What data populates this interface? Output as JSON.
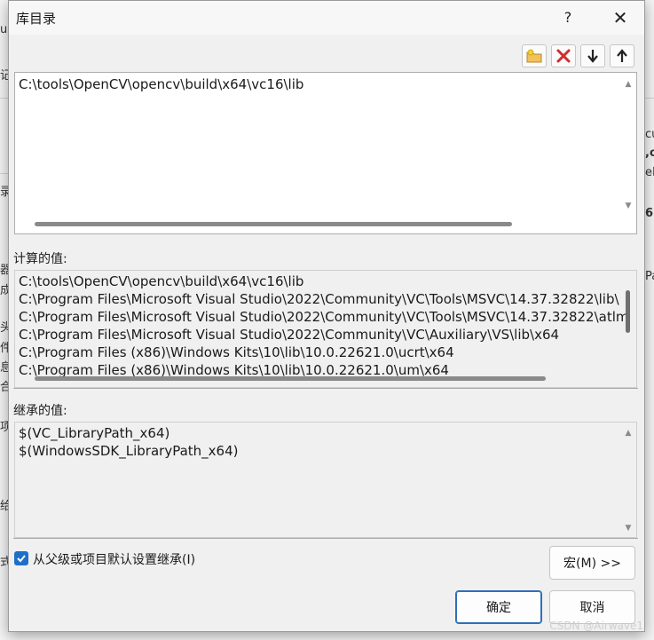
{
  "dialog": {
    "title": "库目录",
    "help_label": "?",
    "close_label": "✕"
  },
  "toolbar": {
    "icons": [
      "new-folder-icon",
      "delete-icon",
      "move-down-icon",
      "move-up-icon"
    ]
  },
  "editor": {
    "lines": [
      "C:\\tools\\OpenCV\\opencv\\build\\x64\\vc16\\lib"
    ]
  },
  "evaluated": {
    "label": "计算的值:",
    "lines": [
      "C:\\tools\\OpenCV\\opencv\\build\\x64\\vc16\\lib",
      "C:\\Program Files\\Microsoft Visual Studio\\2022\\Community\\VC\\Tools\\MSVC\\14.37.32822\\lib\\",
      "C:\\Program Files\\Microsoft Visual Studio\\2022\\Community\\VC\\Tools\\MSVC\\14.37.32822\\atlm",
      "C:\\Program Files\\Microsoft Visual Studio\\2022\\Community\\VC\\Auxiliary\\VS\\lib\\x64",
      "C:\\Program Files (x86)\\Windows Kits\\10\\lib\\10.0.22621.0\\ucrt\\x64",
      "C:\\Program Files (x86)\\Windows Kits\\10\\lib\\10.0.22621.0\\um\\x64"
    ]
  },
  "inherited": {
    "label": "继承的值:",
    "lines": [
      "$(VC_LibraryPath_x64)",
      "$(WindowsSDK_LibraryPath_x64)"
    ]
  },
  "inherit_checkbox": {
    "checked": true,
    "label": "从父级或项目默认设置继承(I)"
  },
  "buttons": {
    "macros": "宏(M) >>",
    "ok": "确定",
    "cancel": "取消"
  },
  "background": {
    "fragments": [
      "记",
      "uc",
      "cu",
      ",o",
      "eP",
      "6",
      "Pa",
      "器",
      "成",
      "头",
      "件",
      "息",
      "合",
      "项",
      "给",
      "式",
      "录"
    ]
  },
  "watermark": "CSDN @Airwave1"
}
